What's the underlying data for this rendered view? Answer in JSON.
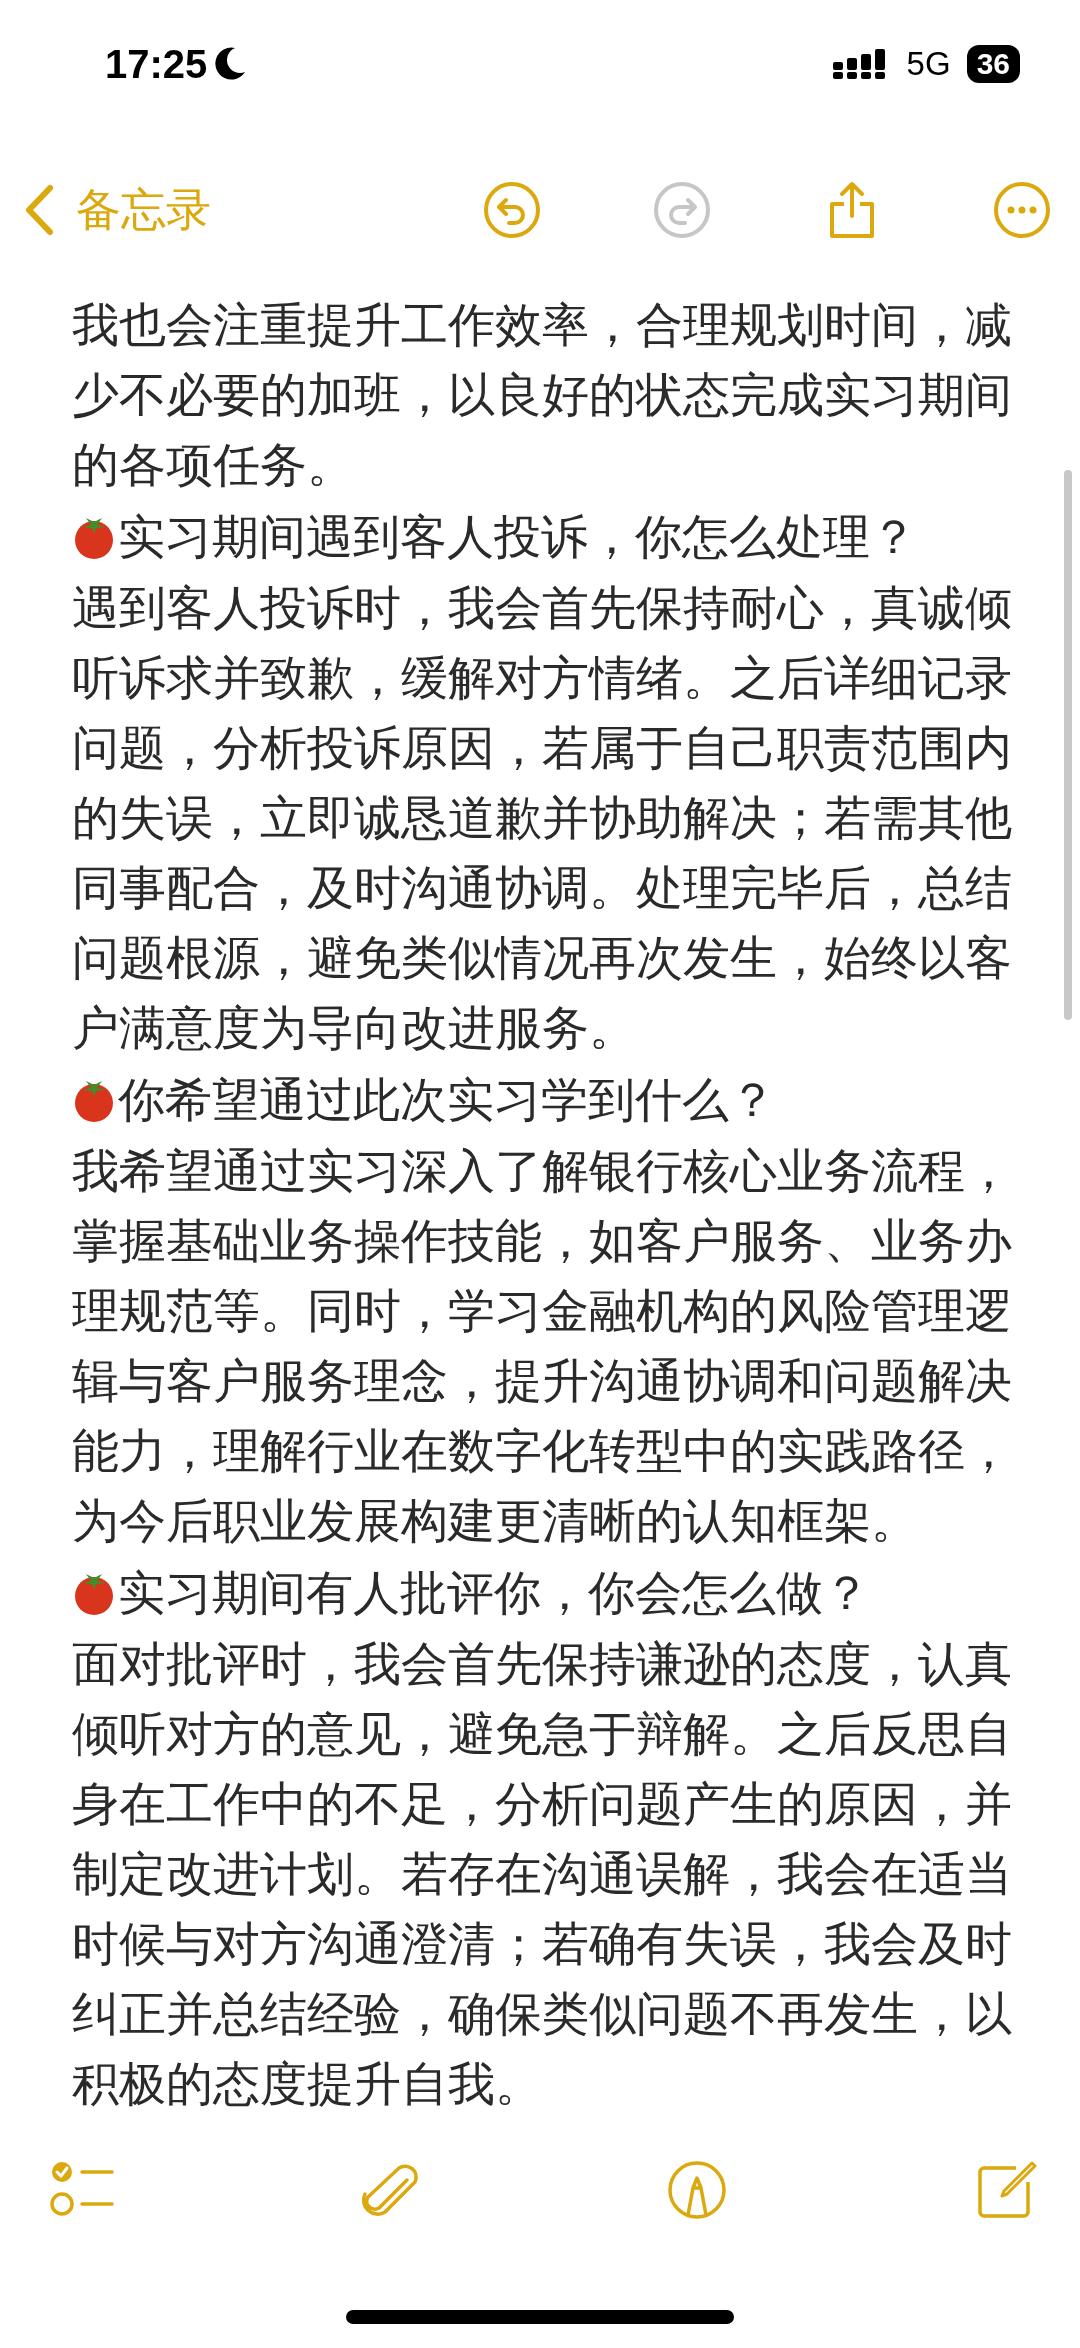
{
  "status_bar": {
    "time": "17:25",
    "network": "5G",
    "battery": "36"
  },
  "nav": {
    "back_label": "备忘录",
    "actions": [
      {
        "kind": "undo",
        "disabled": false
      },
      {
        "kind": "redo",
        "disabled": true
      },
      {
        "kind": "share",
        "disabled": false
      },
      {
        "kind": "more",
        "disabled": false
      }
    ]
  },
  "note": [
    {
      "kind": "text",
      "text": "我也会注重提升工作效率，合理规划时间，减少不必要的加班，以良好的状态完成实习期间的各项任务。"
    },
    {
      "kind": "heading",
      "text": "实习期间遇到客人投诉，你怎么处理？"
    },
    {
      "kind": "text",
      "text": "遇到客人投诉时，我会首先保持耐心，真诚倾听诉求并致歉，缓解对方情绪。之后详细记录问题，分析投诉原因，若属于自己职责范围内的失误，立即诚恳道歉并协助解决；若需其他同事配合，及时沟通协调。处理完毕后，总结问题根源，避免类似情况再次发生，始终以客户满意度为导向改进服务。"
    },
    {
      "kind": "heading",
      "text": "你希望通过此次实习学到什么？"
    },
    {
      "kind": "text",
      "text": "我希望通过实习深入了解银行核心业务流程，掌握基础业务操作技能，如客户服务、业务办理规范等。同时，学习金融机构的风险管理逻辑与客户服务理念，提升沟通协调和问题解决能力，理解行业在数字化转型中的实践路径，为今后职业发展构建更清晰的认知框架。"
    },
    {
      "kind": "heading",
      "text": "实习期间有人批评你，你会怎么做？"
    },
    {
      "kind": "text",
      "text": "面对批评时，我会首先保持谦逊的态度，认真倾听对方的意见，避免急于辩解。之后反思自身在工作中的不足，分析问题产生的原因，并制定改进计划。若存在沟通误解，我会在适当时候与对方沟通澄清；若确有失误，我会及时纠正并总结经验，确保类似问题不再发生，以积极的态度提升自我。"
    }
  ],
  "toolbar": [
    {
      "kind": "checklist"
    },
    {
      "kind": "attach"
    },
    {
      "kind": "markup"
    },
    {
      "kind": "compose"
    }
  ]
}
